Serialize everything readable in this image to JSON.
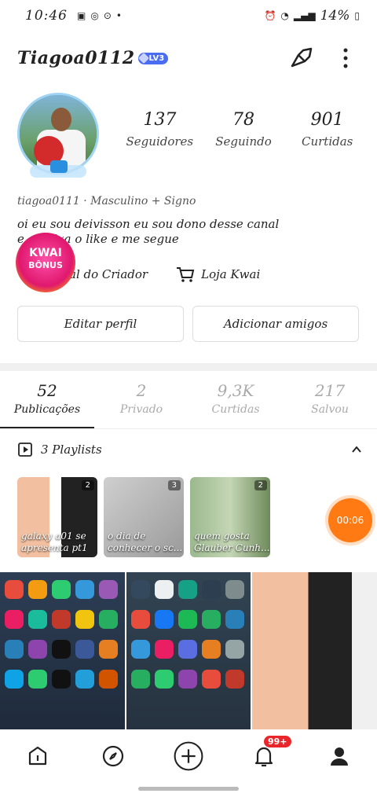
{
  "status_bar": {
    "time": "10:46",
    "battery": "14%",
    "network": "Vo))\nLTE1"
  },
  "profile": {
    "username": "Tiagoa0112",
    "level": "LV3",
    "stats": [
      {
        "value": "137",
        "label": "Seguidores"
      },
      {
        "value": "78",
        "label": "Seguindo"
      },
      {
        "value": "901",
        "label": "Curtidas"
      }
    ],
    "meta": "tiagoa0111 · Masculino    + Signo",
    "bio_line1": "oi eu sou deivisson eu sou dono desse canal",
    "bio_line2": "e... deixa o like e me segue",
    "kwai_bonus_line1": "KWAI",
    "kwai_bonus_line2": "BÔNUS",
    "creator_link": "al do Criador",
    "shop_link": "Loja Kwai",
    "edit_button": "Editar perfil",
    "add_friends_button": "Adicionar amigos"
  },
  "tabs": [
    {
      "count": "52",
      "label": "Publicações"
    },
    {
      "count": "2",
      "label": "Privado"
    },
    {
      "count": "9,3K",
      "label": "Curtidas"
    },
    {
      "count": "217",
      "label": "Salvou"
    }
  ],
  "playlists": {
    "header": "3 Playlists",
    "items": [
      {
        "title": "galaxy a01 se apresenta pt1",
        "count": "2"
      },
      {
        "title": "o dia de conhecer o sc...",
        "count": "3"
      },
      {
        "title": "quem gosta Glauber Cunh...",
        "count": "2"
      }
    ]
  },
  "timer": "00:06",
  "notification_badge": "99+",
  "colors": {
    "accent": "#ff7a12",
    "badge": "#e8262c",
    "level": "#4a6cf0"
  }
}
